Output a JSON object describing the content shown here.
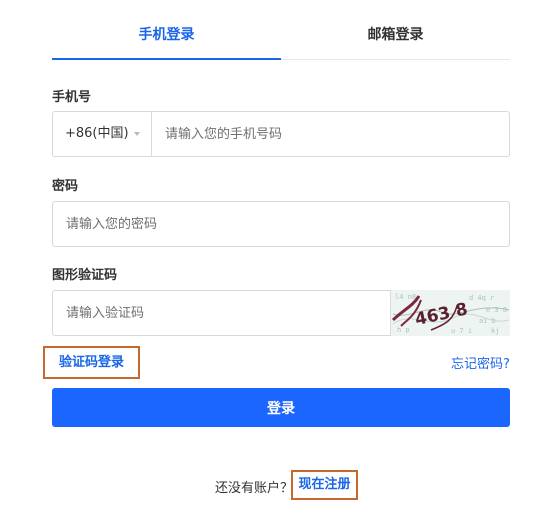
{
  "tabs": {
    "phone_label": "手机登录",
    "email_label": "邮箱登录"
  },
  "phone": {
    "label": "手机号",
    "country_code": "+86(中国)",
    "placeholder": "请输入您的手机号码"
  },
  "password": {
    "label": "密码",
    "placeholder": "请输入您的密码"
  },
  "captcha": {
    "label": "图形验证码",
    "placeholder": "请输入验证码",
    "image_text": "463 8"
  },
  "links": {
    "sms_login": "验证码登录",
    "forgot_password": "忘记密码?"
  },
  "login_button": "登录",
  "footer": {
    "no_account": "还没有账户？",
    "register": "现在注册"
  },
  "colors": {
    "accent": "#1a66e8",
    "button": "#1a66ff",
    "highlight_box": "#c46a2f"
  }
}
